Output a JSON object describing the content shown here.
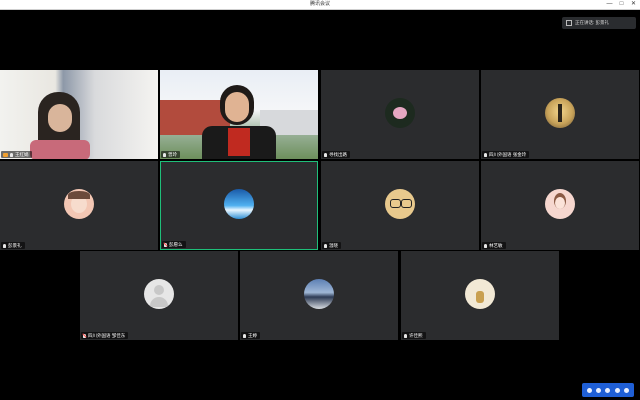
{
  "window": {
    "title": "腾讯会议",
    "controls": [
      "—",
      "□",
      "✕"
    ]
  },
  "speaker": {
    "label": "正在讲话: 彭景礼"
  },
  "participants": [
    {
      "name": "王红娟",
      "mic": "on",
      "video": true,
      "sharing": true,
      "avatar_color": "#c9a98f"
    },
    {
      "name": "曾玲",
      "mic": "on",
      "video": true,
      "avatar_color": "#8d2a22"
    },
    {
      "name": "寻找出路",
      "mic": "on",
      "avatar_color": "#e6a7c2"
    },
    {
      "name": "四川外国语 张金玲",
      "mic": "on",
      "avatar_color": "#c8a35a"
    },
    {
      "name": "彭景礼",
      "mic": "on",
      "avatar_color": "#f3c7b4"
    },
    {
      "name": "彭愿么",
      "mic": "muted",
      "active": true,
      "avatar_color": "#2f8fd4"
    },
    {
      "name": "温晓",
      "mic": "on",
      "avatar_color": "#e8c98d"
    },
    {
      "name": "林艺敏",
      "mic": "on",
      "avatar_color": "#f6d7cf"
    },
    {
      "name": "四川外国语 邹佳东",
      "mic": "muted",
      "avatar_color": "#e6e6e6"
    },
    {
      "name": "王婷",
      "mic": "on",
      "avatar_color": "#7fa0c8"
    },
    {
      "name": "许佳熙",
      "mic": "on",
      "avatar_color": "#f2e9d5"
    }
  ],
  "toolbar": {
    "icons": [
      "settings-icon",
      "mic-icon",
      "camera-icon",
      "share-icon",
      "more-icon"
    ]
  }
}
